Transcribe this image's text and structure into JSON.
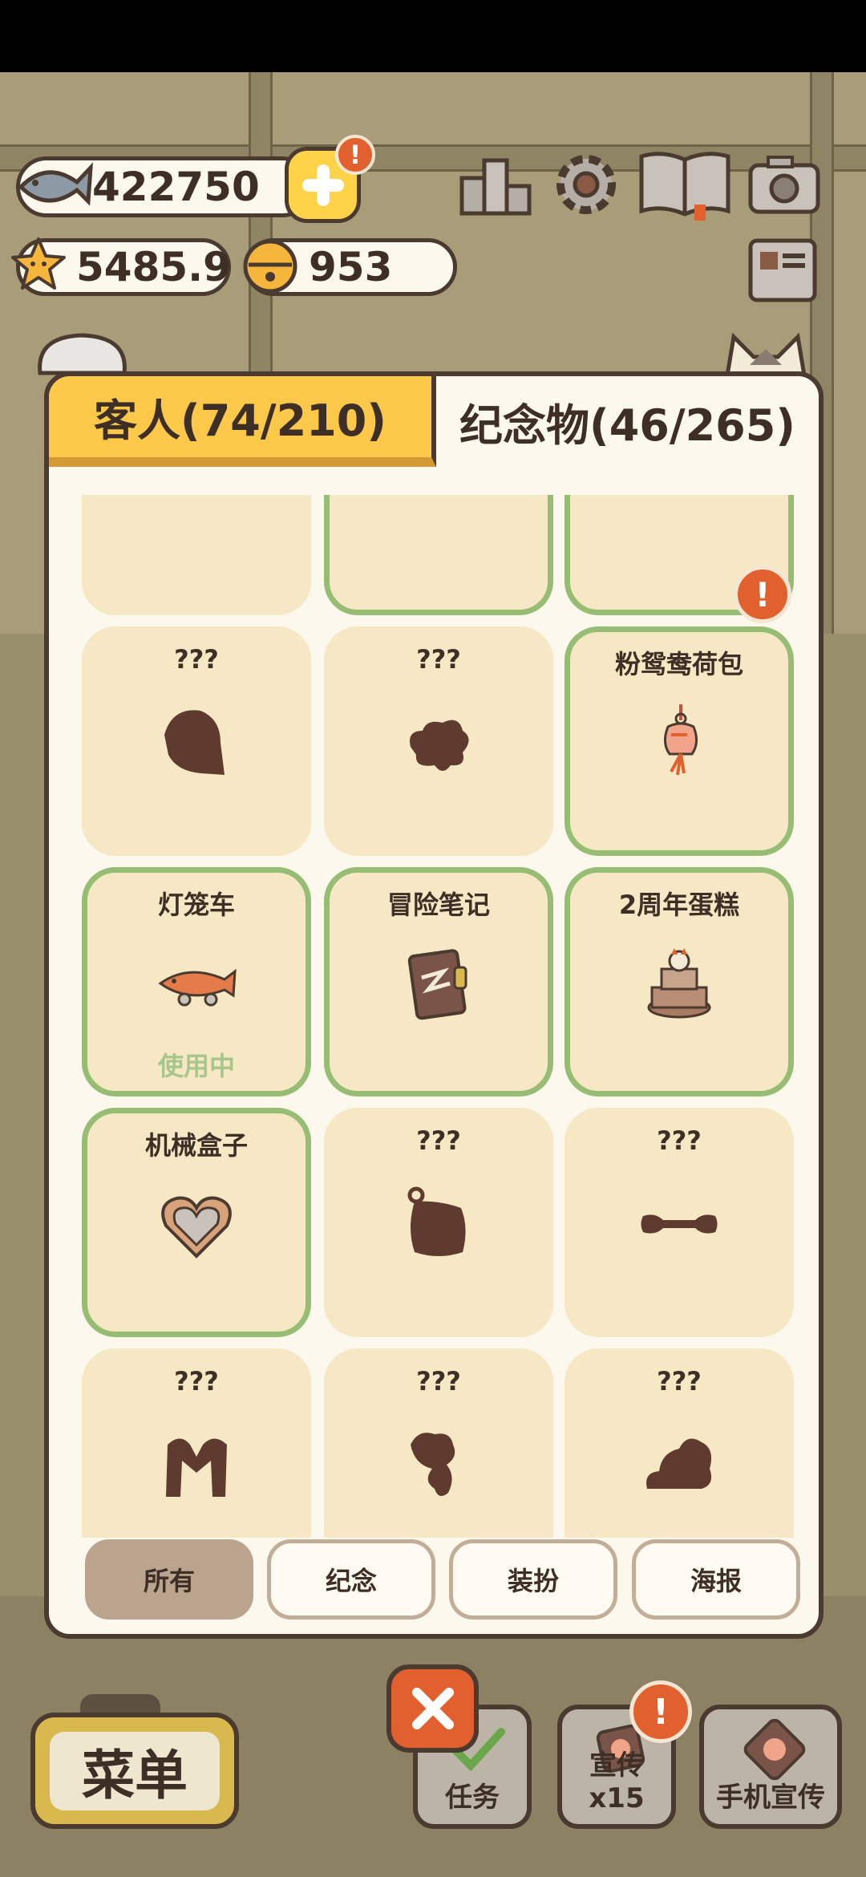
{
  "hud": {
    "fish": "422750",
    "stars": "5485.9",
    "bells": "953",
    "alert": "!",
    "icons": [
      "fish-icon",
      "star-icon",
      "bell-icon",
      "plus-icon",
      "ranking-icon",
      "settings-icon",
      "catalog-book-icon",
      "camera-icon",
      "newspaper-icon"
    ]
  },
  "tabs": {
    "guests": "客人(74/210)",
    "souvenirs": "纪念物(46/265)"
  },
  "grid": {
    "items": [
      {
        "title": "???",
        "owned": false,
        "icon": "shell-silhouette"
      },
      {
        "title": "???",
        "owned": false,
        "icon": "flower-silhouette"
      },
      {
        "title": "粉鸳鸯荷包",
        "owned": true,
        "icon": "pouch-charm-icon",
        "badge": "!"
      },
      {
        "title": "灯笼车",
        "owned": true,
        "icon": "fish-lantern-cart-icon",
        "status": "使用中"
      },
      {
        "title": "冒险笔记",
        "owned": true,
        "icon": "adventure-notebook-icon"
      },
      {
        "title": "2周年蛋糕",
        "owned": true,
        "icon": "anniversary-cake-icon"
      },
      {
        "title": "机械盒子",
        "owned": true,
        "icon": "heart-box-icon"
      },
      {
        "title": "???",
        "owned": false,
        "icon": "bag-silhouette"
      },
      {
        "title": "???",
        "owned": false,
        "icon": "bone-silhouette"
      },
      {
        "title": "???",
        "owned": false,
        "icon": "arch-silhouette"
      },
      {
        "title": "???",
        "owned": false,
        "icon": "flower-stem-silhouette"
      },
      {
        "title": "???",
        "owned": false,
        "icon": "cloud-silhouette"
      }
    ]
  },
  "filters": {
    "all": "所有",
    "souvenir": "纪念",
    "dress_up": "装扮",
    "poster": "海报"
  },
  "bottom": {
    "menu": "菜单",
    "tasks": "任务",
    "promo": "宣传x15",
    "phone_promo": "手机宣传",
    "alert": "!"
  },
  "colors": {
    "accent_yellow": "#fbc84a",
    "owned_border": "#97bd74",
    "cell_bg": "#f6e8c4",
    "outline": "#4a3a30",
    "alert_orange": "#e2602d"
  }
}
